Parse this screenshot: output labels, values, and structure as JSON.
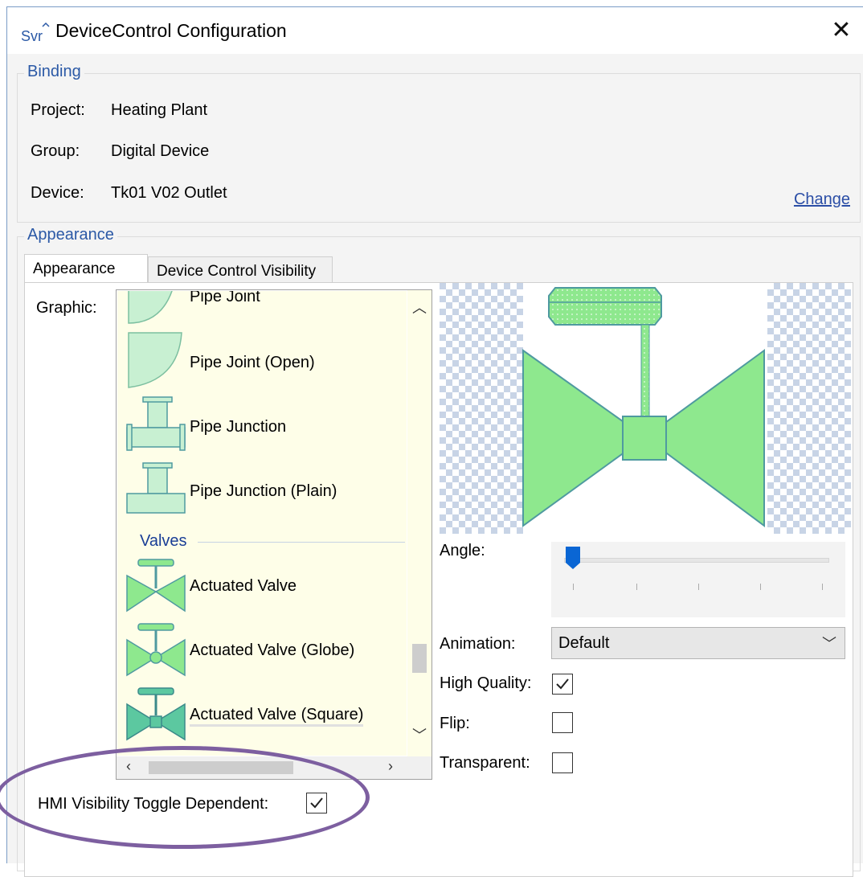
{
  "window": {
    "title": "DeviceControl Configuration",
    "close_glyph": "✕",
    "icon_text": "Svr"
  },
  "binding": {
    "legend": "Binding",
    "project_label": "Project:",
    "project_value": "Heating Plant",
    "group_label": "Group:",
    "group_value": "Digital Device",
    "device_label": "Device:",
    "device_value": "Tk01 V02 Outlet",
    "change_link": "Change"
  },
  "appearance": {
    "legend": "Appearance",
    "tabs": [
      {
        "label": "Appearance",
        "active": true
      },
      {
        "label": "Device Control Visibility",
        "active": false
      }
    ],
    "graphic_label": "Graphic:",
    "graphic_list": {
      "items": [
        {
          "label": "Pipe Joint"
        },
        {
          "label": "Pipe Joint (Open)"
        },
        {
          "label": "Pipe Junction"
        },
        {
          "label": "Pipe Junction (Plain)"
        },
        {
          "category": "Valves"
        },
        {
          "label": "Actuated Valve"
        },
        {
          "label": "Actuated Valve (Globe)"
        },
        {
          "label": "Actuated Valve (Square)",
          "selected": true
        }
      ]
    },
    "angle_label": "Angle:",
    "angle_value": 0,
    "animation_label": "Animation:",
    "animation_value": "Default",
    "high_quality_label": "High Quality:",
    "high_quality": true,
    "flip_label": "Flip:",
    "flip": false,
    "transparent_label": "Transparent:",
    "transparent": false,
    "hmi_label": "HMI Visibility Toggle Dependent:",
    "hmi_checked": true
  },
  "colors": {
    "accent": "#2b59a6",
    "valve_green": "#8ee88e",
    "valve_stroke": "#4f9aa0",
    "highlight_ellipse": "#7d5fa0"
  },
  "icons": [
    "app-icon",
    "close-icon",
    "chevron-up-icon",
    "chevron-down-icon",
    "chevron-left-icon",
    "chevron-right-icon",
    "checkmark-icon",
    "slider-knob-icon"
  ]
}
